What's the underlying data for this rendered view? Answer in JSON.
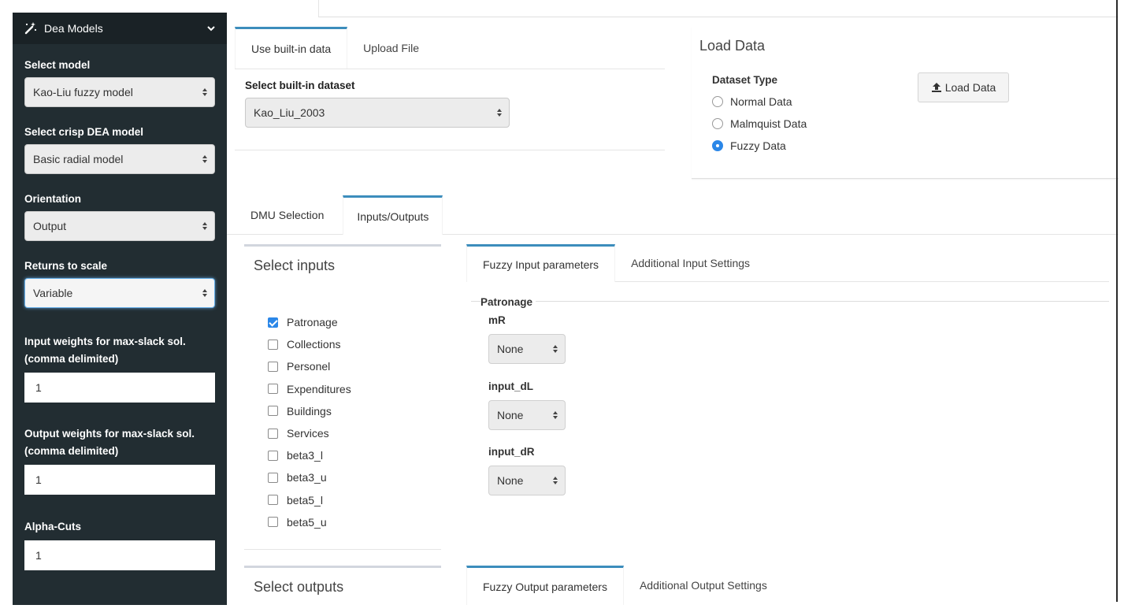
{
  "sidebar": {
    "header_title": "Dea Models",
    "fields": [
      {
        "label": "Select model",
        "value": "Kao-Liu fuzzy model"
      },
      {
        "label": "Select crisp DEA model",
        "value": "Basic radial model"
      },
      {
        "label": "Orientation",
        "value": "Output"
      },
      {
        "label": "Returns to scale",
        "value": "Variable"
      }
    ],
    "inputs": [
      {
        "label_line1": "Input weights for max-slack sol.",
        "label_line2": "(comma delimited)",
        "value": "1"
      },
      {
        "label_line1": "Output weights for max-slack sol.",
        "label_line2": "(comma delimited)",
        "value": "1"
      },
      {
        "label_line1": "Alpha-Cuts",
        "value": "1"
      }
    ]
  },
  "data_panel": {
    "tabs": [
      "Use built-in data",
      "Upload File"
    ],
    "dataset_label": "Select built-in dataset",
    "dataset_value": "Kao_Liu_2003"
  },
  "load_panel": {
    "title": "Load Data",
    "dataset_type_label": "Dataset Type",
    "options": [
      "Normal Data",
      "Malmquist Data",
      "Fuzzy Data"
    ],
    "selected": "Fuzzy Data",
    "button_label": "Load Data"
  },
  "main_tabs": [
    "DMU Selection",
    "Inputs/Outputs"
  ],
  "inputs_box": {
    "title": "Select inputs",
    "items": [
      {
        "label": "Patronage",
        "checked": true
      },
      {
        "label": "Collections",
        "checked": false
      },
      {
        "label": "Personel",
        "checked": false
      },
      {
        "label": "Expenditures",
        "checked": false
      },
      {
        "label": "Buildings",
        "checked": false
      },
      {
        "label": "Services",
        "checked": false
      },
      {
        "label": "beta3_l",
        "checked": false
      },
      {
        "label": "beta3_u",
        "checked": false
      },
      {
        "label": "beta5_l",
        "checked": false
      },
      {
        "label": "beta5_u",
        "checked": false
      }
    ]
  },
  "fuzzy_input": {
    "tabs": [
      "Fuzzy Input parameters",
      "Additional Input Settings"
    ],
    "group": "Patronage",
    "params": [
      {
        "label": "mR",
        "value": "None"
      },
      {
        "label": "input_dL",
        "value": "None"
      },
      {
        "label": "input_dR",
        "value": "None"
      }
    ]
  },
  "outputs_box": {
    "title": "Select outputs"
  },
  "fuzzy_output": {
    "tabs": [
      "Fuzzy Output parameters",
      "Additional Output Settings"
    ]
  },
  "colors": {
    "sidebar_bg": "#222d32",
    "accent": "#3c8dbc",
    "radio_checked": "#2b87e8"
  }
}
